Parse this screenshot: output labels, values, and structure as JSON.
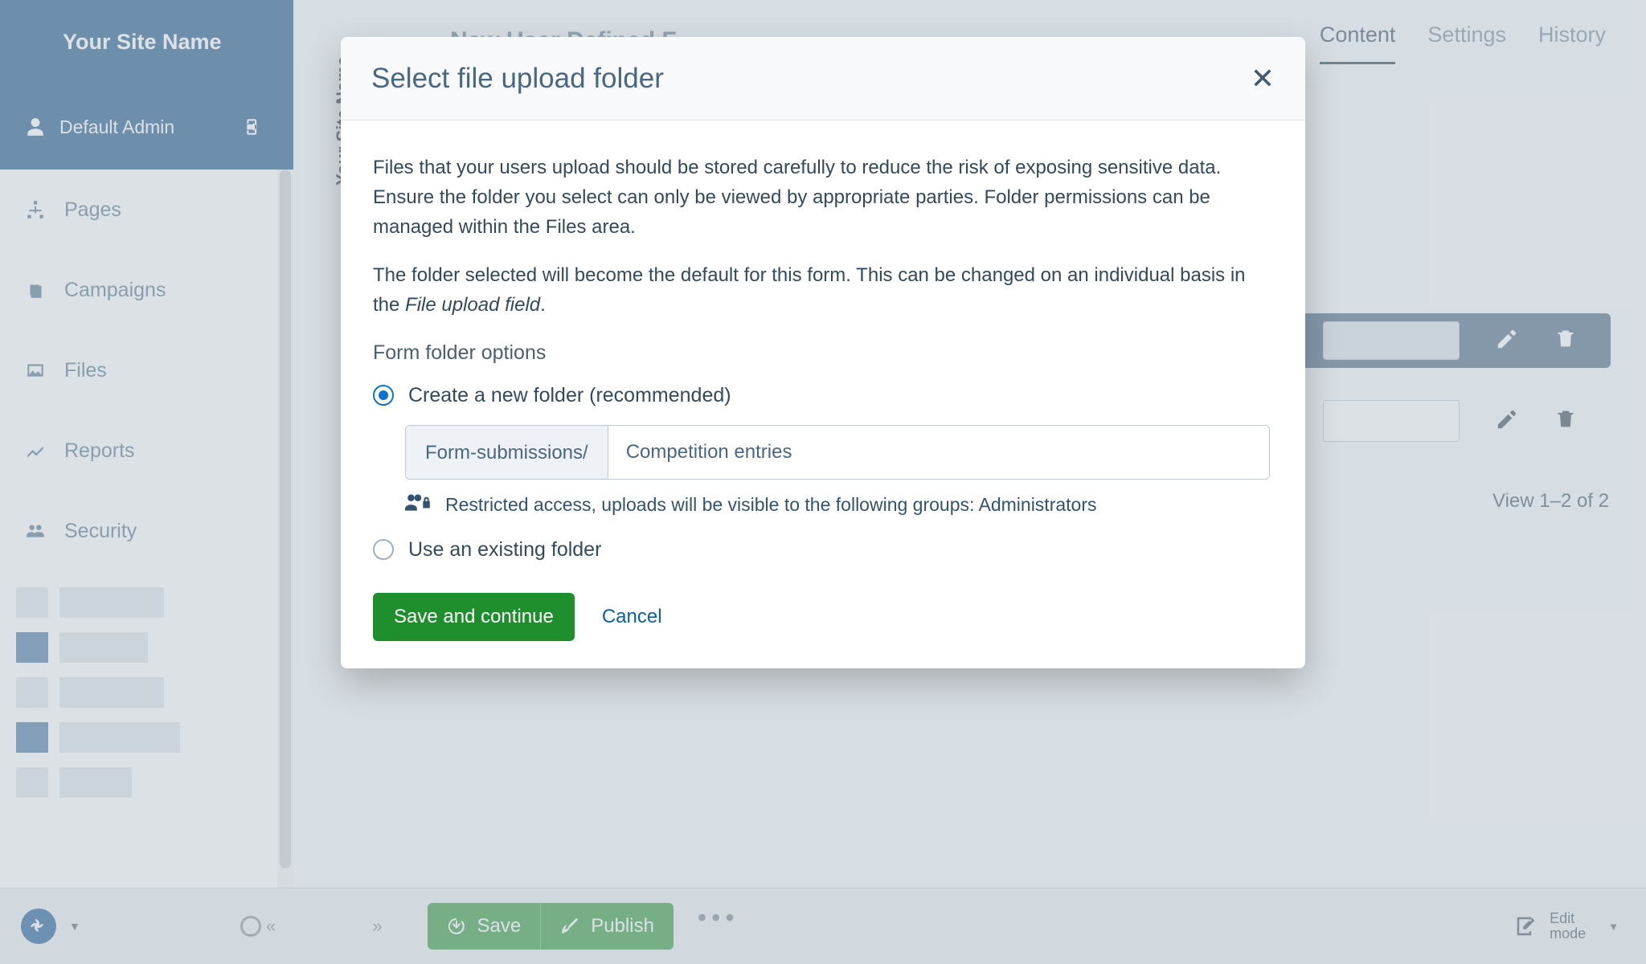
{
  "site_name": "Your Site Name",
  "user": {
    "name": "Default Admin"
  },
  "sidebar": {
    "items": [
      {
        "label": "Pages"
      },
      {
        "label": "Campaigns"
      },
      {
        "label": "Files"
      },
      {
        "label": "Reports"
      },
      {
        "label": "Security"
      }
    ]
  },
  "vertical_tab_label": "Your Site Name",
  "tabs": {
    "content": "Content",
    "settings": "Settings",
    "history": "History",
    "active": "content"
  },
  "background": {
    "back_label": "",
    "page_heading": "New User Defined F...",
    "view_status": "View 1–2 of 2"
  },
  "bottom_bar": {
    "save": "Save",
    "publish": "Publish",
    "edit_mode_line1": "Edit",
    "edit_mode_line2": "mode"
  },
  "modal": {
    "title": "Select file upload folder",
    "para1": "Files that your users upload should be stored carefully to reduce the risk of exposing sensitive data. Ensure the folder you select can only be viewed by appropriate parties. Folder permissions can be managed within the Files area.",
    "para2_a": "The folder selected will become the default for this form. This can be changed on an individual basis in the ",
    "para2_em": "File upload field",
    "para2_b": ".",
    "section_label": "Form folder options",
    "opt_create": "Create a new folder (recommended)",
    "prefix": "Form-submissions/",
    "folder_value": "Competition entries",
    "restricted": "Restricted access, uploads will be visible to the following groups: Administrators",
    "opt_existing": "Use an existing folder",
    "save_continue": "Save and continue",
    "cancel": "Cancel"
  }
}
